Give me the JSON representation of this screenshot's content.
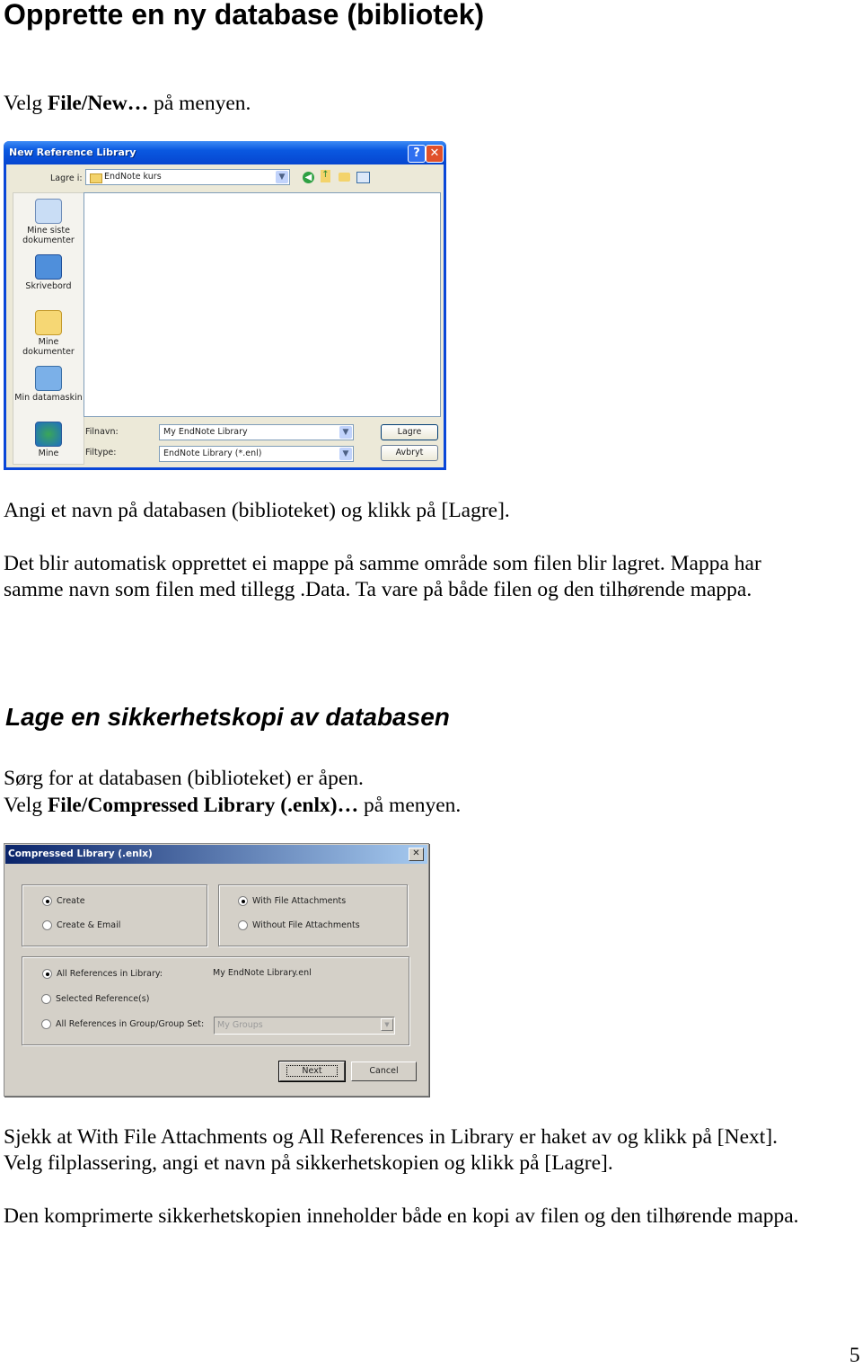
{
  "heading1": "Opprette en ny database (bibliotek)",
  "p1": {
    "pre": "Velg ",
    "bold": "File/New…",
    "post": " på menyen."
  },
  "dialog1": {
    "title": "New Reference Library",
    "help_icon": "help-icon",
    "close_icon": "close-icon",
    "save_in_label": "Lagre i:",
    "save_in_value": "EndNote kurs",
    "toolbar_icons": [
      "back-icon",
      "up-folder-icon",
      "new-folder-icon",
      "view-menu-icon"
    ],
    "places": [
      {
        "label": "Mine siste dokumenter",
        "icon": "recent-documents-icon"
      },
      {
        "label": "Skrivebord",
        "icon": "desktop-icon"
      },
      {
        "label": "Mine dokumenter",
        "icon": "my-documents-icon"
      },
      {
        "label": "Min datamaskin",
        "icon": "my-computer-icon"
      },
      {
        "label": "Mine",
        "icon": "network-icon"
      }
    ],
    "filename_label": "Filnavn:",
    "filename_value": "My EndNote Library",
    "filetype_label": "Filtype:",
    "filetype_value": "EndNote Library (*.enl)",
    "save_button": "Lagre",
    "cancel_button": "Avbryt"
  },
  "p2": "Angi et navn på databasen (biblioteket) og klikk på [Lagre].",
  "p3a": "Det blir automatisk opprettet ei mappe på samme område som filen blir lagret. Mappa har",
  "p3b": "samme navn som filen med tillegg .Data. Ta vare på både filen og den tilhørende mappa.",
  "heading2": "Lage en sikkerhetskopi av databasen",
  "p4": "Sørg for at databasen (biblioteket) er åpen.",
  "p5": {
    "pre": "Velg ",
    "bold": "File/Compressed Library (.enlx)…",
    "post": " på menyen."
  },
  "dialog2": {
    "title": "Compressed Library (.enlx)",
    "close_icon": "close-icon",
    "mode_options": [
      {
        "label": "Create",
        "checked": true
      },
      {
        "label": "Create & Email",
        "checked": false
      }
    ],
    "attachment_options": [
      {
        "label": "With File Attachments",
        "checked": true
      },
      {
        "label": "Without File Attachments",
        "checked": false
      }
    ],
    "scope_options": [
      {
        "label": "All References in Library:",
        "checked": true
      },
      {
        "label": "Selected Reference(s)",
        "checked": false
      },
      {
        "label": "All References in Group/Group Set:",
        "checked": false
      }
    ],
    "library_name": "My EndNote Library.enl",
    "group_select": "My Groups",
    "next_button": "Next",
    "cancel_button": "Cancel"
  },
  "p6": "Sjekk at With File Attachments og All References in Library er haket av og klikk på [Next].",
  "p7": "Velg filplassering, angi et navn på sikkerhetskopien og klikk på [Lagre].",
  "p8": "Den komprimerte sikkerhetskopien inneholder både en kopi av filen og den tilhørende mappa.",
  "page_number": "5"
}
